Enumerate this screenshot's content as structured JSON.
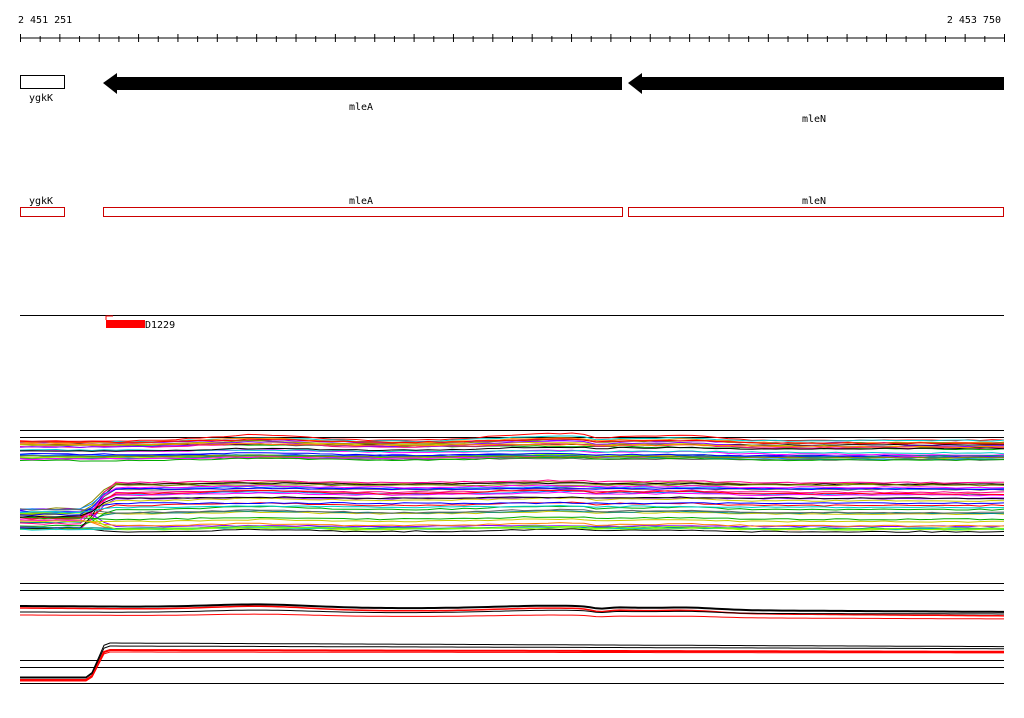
{
  "coordinates": {
    "start": "2 451 251",
    "end": "2 453 750"
  },
  "genes_strand": [
    {
      "id": "ygkK",
      "label": "ygkK",
      "style": "open-box"
    },
    {
      "id": "mleA",
      "label": "mleA",
      "style": "arrow-left"
    },
    {
      "id": "mleN",
      "label": "mleN",
      "style": "arrow-left"
    }
  ],
  "genes_track": [
    {
      "id": "ygkK",
      "label": "ygkK"
    },
    {
      "id": "mleA",
      "label": "mleA"
    },
    {
      "id": "mleN",
      "label": "mleN"
    }
  ],
  "feature": {
    "label": "D1229",
    "color": "#ff0000"
  },
  "colors": {
    "axis": "#000000",
    "gene_box": "#cc0000",
    "feature": "#ff0000",
    "profile_highlight": "#ff0000"
  }
}
